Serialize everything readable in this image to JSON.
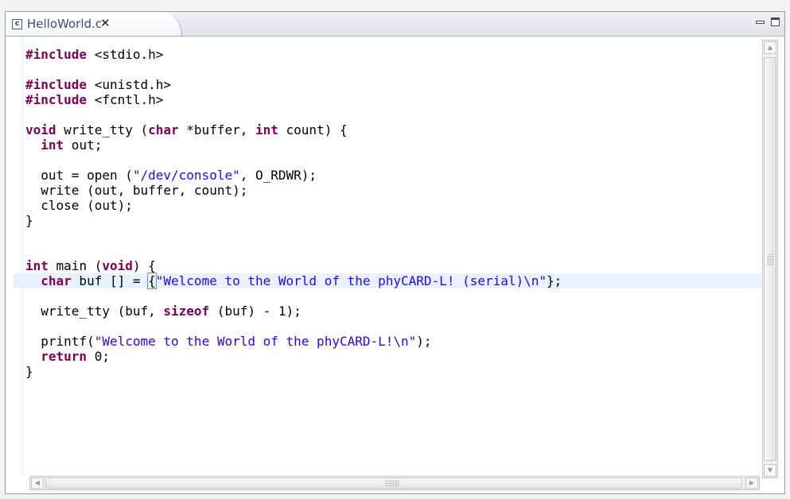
{
  "tab": {
    "icon": "c-source-file-icon",
    "icon_glyph": "c",
    "label": "HelloWorld.c",
    "close_glyph": "✕"
  },
  "colors": {
    "keyword": "#7f0055",
    "string": "#2a00ff",
    "current_line": "#e8f2fe"
  },
  "code": [
    [
      {
        "k": "kw",
        "t": "#include"
      },
      {
        "t": " <stdio.h>"
      }
    ],
    [],
    [
      {
        "k": "kw",
        "t": "#include"
      },
      {
        "t": " <unistd.h>"
      }
    ],
    [
      {
        "k": "kw",
        "t": "#include"
      },
      {
        "t": " <fcntl.h>"
      }
    ],
    [],
    [
      {
        "k": "kw",
        "t": "void"
      },
      {
        "t": " write_tty ("
      },
      {
        "k": "kw",
        "t": "char"
      },
      {
        "t": " *buffer, "
      },
      {
        "k": "kw",
        "t": "int"
      },
      {
        "t": " count) {"
      }
    ],
    [
      {
        "t": "  "
      },
      {
        "k": "kw",
        "t": "int"
      },
      {
        "t": " out;"
      }
    ],
    [],
    [
      {
        "t": "  out = open ("
      },
      {
        "k": "str",
        "t": "\"/dev/console\""
      },
      {
        "t": ", O_RDWR);"
      }
    ],
    [
      {
        "t": "  write (out, buffer, count);"
      }
    ],
    [
      {
        "t": "  close (out);"
      }
    ],
    [
      {
        "t": "}"
      }
    ],
    [],
    [],
    [
      {
        "k": "kw",
        "t": "int"
      },
      {
        "t": " main ("
      },
      {
        "k": "kw",
        "t": "void"
      },
      {
        "t": ") {"
      }
    ],
    [
      {
        "t": "  "
      },
      {
        "k": "kw",
        "t": "char"
      },
      {
        "t": " buf [] = "
      },
      {
        "k": "bracket",
        "t": "{"
      },
      {
        "k": "str",
        "t": "\"Welcome to the World of the phyCARD-L! (serial)\\n\""
      },
      {
        "t": "};"
      }
    ],
    [],
    [
      {
        "t": "  write_tty (buf, "
      },
      {
        "k": "kw",
        "t": "sizeof"
      },
      {
        "t": " (buf) - 1);"
      }
    ],
    [],
    [
      {
        "t": "  printf("
      },
      {
        "k": "str",
        "t": "\"Welcome to the World of the phyCARD-L!\\n\""
      },
      {
        "t": ");"
      }
    ],
    [
      {
        "t": "  "
      },
      {
        "k": "kw",
        "t": "return"
      },
      {
        "t": " 0;"
      }
    ],
    [
      {
        "t": "}"
      }
    ]
  ],
  "current_line_index": 15
}
